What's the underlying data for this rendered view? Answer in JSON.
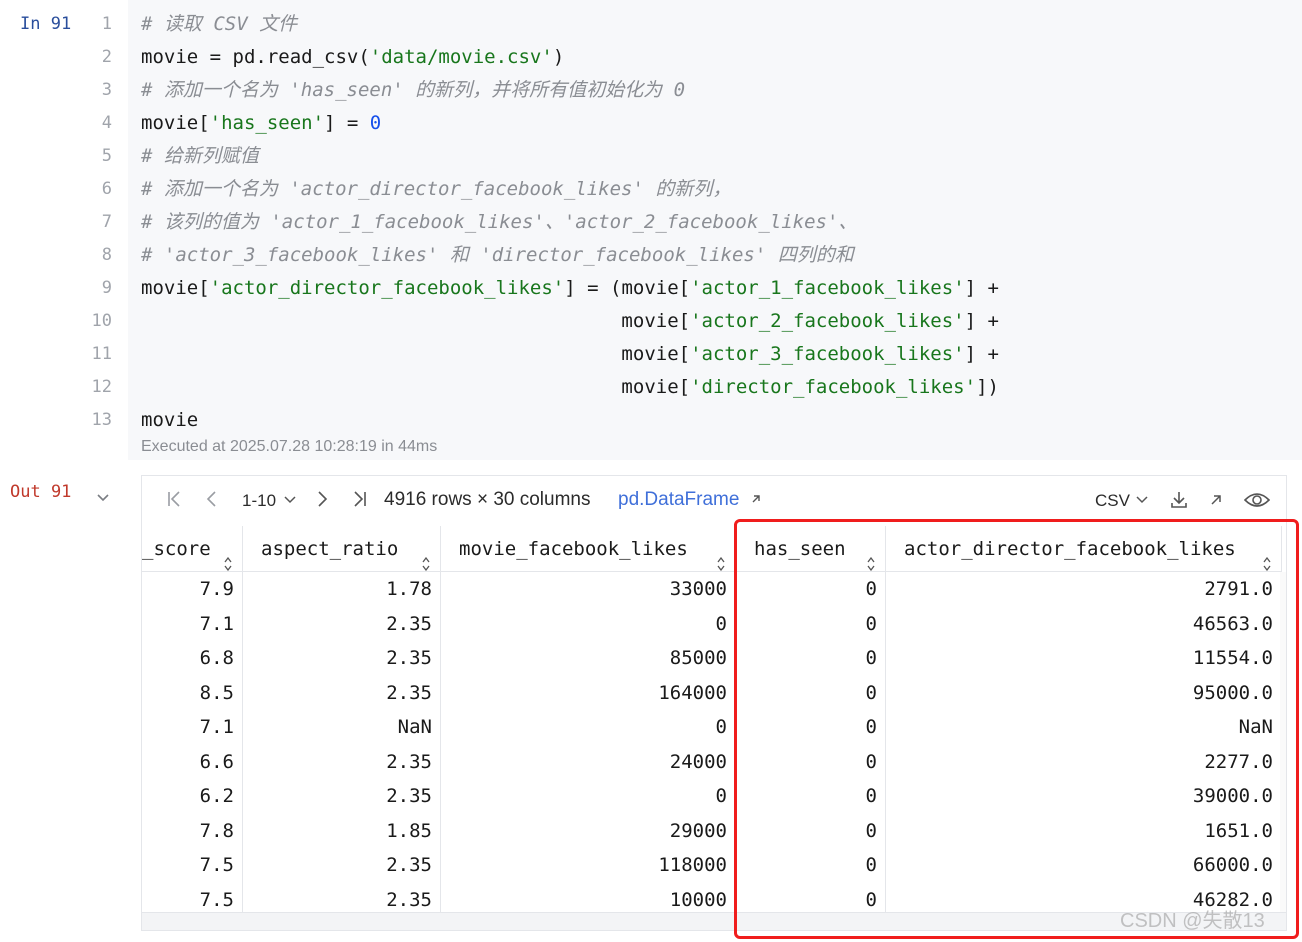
{
  "input_cell": {
    "prompt": "In 91",
    "line_numbers": [
      "1",
      "2",
      "3",
      "4",
      "5",
      "6",
      "7",
      "8",
      "9",
      "10",
      "11",
      "12",
      "13"
    ],
    "exec_info": "Executed at 2025.07.28 10:28:19 in 44ms"
  },
  "output_cell": {
    "prompt": "Out 91",
    "toolbar": {
      "page_range": "1-10",
      "rows_cols": "4916 rows × 30 columns",
      "df_link": "pd.DataFrame",
      "export_format": "CSV"
    },
    "table": {
      "columns": [
        "_score",
        "aspect_ratio",
        "movie_facebook_likes",
        "has_seen",
        "actor_director_facebook_likes"
      ],
      "rows": [
        [
          "7.9",
          "1.78",
          "33000",
          "0",
          "2791.0"
        ],
        [
          "7.1",
          "2.35",
          "0",
          "0",
          "46563.0"
        ],
        [
          "6.8",
          "2.35",
          "85000",
          "0",
          "11554.0"
        ],
        [
          "8.5",
          "2.35",
          "164000",
          "0",
          "95000.0"
        ],
        [
          "7.1",
          "NaN",
          "0",
          "0",
          "NaN"
        ],
        [
          "6.6",
          "2.35",
          "24000",
          "0",
          "2277.0"
        ],
        [
          "6.2",
          "2.35",
          "0",
          "0",
          "39000.0"
        ],
        [
          "7.8",
          "1.85",
          "29000",
          "0",
          "1651.0"
        ],
        [
          "7.5",
          "2.35",
          "118000",
          "0",
          "66000.0"
        ],
        [
          "7.5",
          "2.35",
          "10000",
          "0",
          "46282.0"
        ]
      ]
    }
  },
  "watermark": "CSDN @失散13",
  "colors": {
    "highlight": "#f01d1d",
    "link": "#3f6fd9",
    "string": "#18761c",
    "comment": "#8a8d93",
    "number": "#1750eb"
  }
}
